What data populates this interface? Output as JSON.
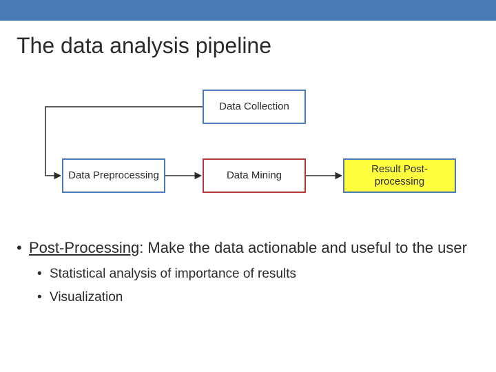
{
  "title": "The data analysis pipeline",
  "nodes": {
    "top": "Data Collection",
    "a": "Data Preprocessing",
    "b": "Data Mining",
    "c": "Result Post-processing"
  },
  "bullets": {
    "main_term": "Post-Processing",
    "main_rest": ": Make the data actionable and useful to the user",
    "sub1": "Statistical analysis of importance of results",
    "sub2": "Visualization"
  },
  "colors": {
    "accent": "#4a7ab8",
    "danger": "#b23a3a",
    "highlight": "#ffff3f"
  }
}
